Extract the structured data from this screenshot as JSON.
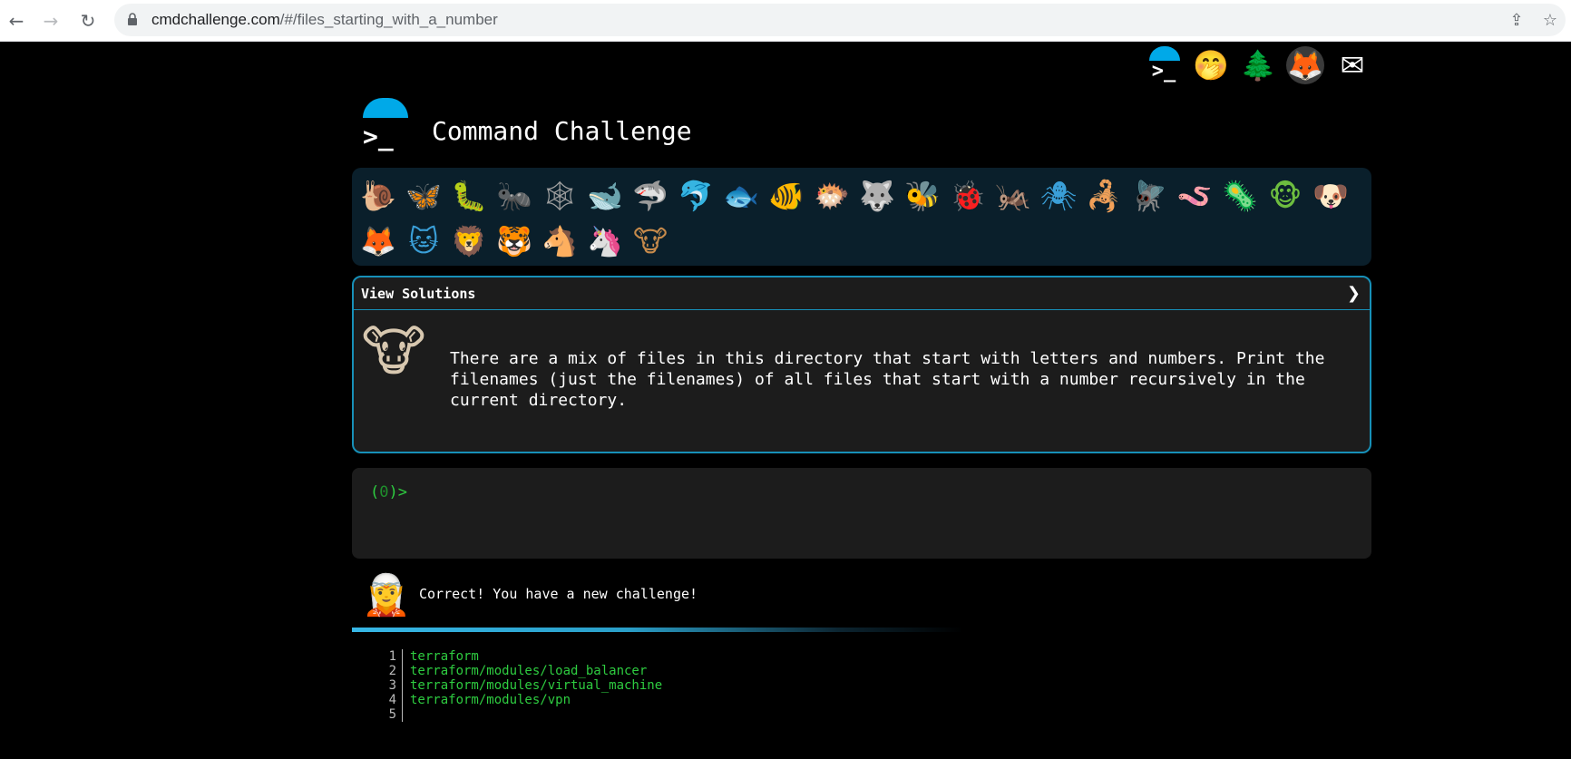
{
  "browser": {
    "url_host": "cmdchallenge.com",
    "url_path": "/#/files_starting_with_a_number",
    "back_icon": "back-arrow-icon",
    "forward_icon": "forward-arrow-icon",
    "reload_icon": "reload-icon",
    "share_icon": "share-icon",
    "star_icon": "bookmark-star-icon"
  },
  "header": {
    "title": "Command Challenge",
    "top_icons": [
      {
        "name": "cmdchallenge-icon",
        "glyph": ">_"
      },
      {
        "name": "oops-face-icon",
        "glyph": "🤭"
      },
      {
        "name": "tree-icon",
        "glyph": "🌲"
      },
      {
        "name": "gitlab-icon",
        "glyph": "🦊"
      },
      {
        "name": "mail-icon",
        "glyph": "✉"
      }
    ]
  },
  "levels": [
    {
      "name": "snail",
      "glyph": "🐌"
    },
    {
      "name": "butterfly",
      "glyph": "🦋"
    },
    {
      "name": "caterpillar",
      "glyph": "🐛"
    },
    {
      "name": "ant",
      "glyph": "🐜"
    },
    {
      "name": "spider-web",
      "glyph": "🕸"
    },
    {
      "name": "whale",
      "glyph": "🐋"
    },
    {
      "name": "shark",
      "glyph": "🦈"
    },
    {
      "name": "dolphin",
      "glyph": "🐬"
    },
    {
      "name": "fish",
      "glyph": "🐟"
    },
    {
      "name": "tropical-fish",
      "glyph": "🐠"
    },
    {
      "name": "blowfish",
      "glyph": "🐡"
    },
    {
      "name": "wolf",
      "glyph": "🐺"
    },
    {
      "name": "bee",
      "glyph": "🐝"
    },
    {
      "name": "ladybug",
      "glyph": "🐞"
    },
    {
      "name": "cricket",
      "glyph": "🦗"
    },
    {
      "name": "spider",
      "glyph": "🕷"
    },
    {
      "name": "scorpion",
      "glyph": "🦂"
    },
    {
      "name": "fly",
      "glyph": "🪰"
    },
    {
      "name": "worm",
      "glyph": "🪱"
    },
    {
      "name": "microbe",
      "glyph": "🦠"
    },
    {
      "name": "monkey",
      "glyph": "🐵"
    },
    {
      "name": "dog",
      "glyph": "🐶"
    },
    {
      "name": "fox",
      "glyph": "🦊"
    },
    {
      "name": "cat",
      "glyph": "🐱"
    },
    {
      "name": "lion",
      "glyph": "🦁"
    },
    {
      "name": "tiger",
      "glyph": "🐯"
    },
    {
      "name": "horse",
      "glyph": "🐴"
    },
    {
      "name": "unicorn",
      "glyph": "🦄"
    },
    {
      "name": "cow",
      "glyph": "🐮"
    }
  ],
  "solutions": {
    "title": "View Solutions",
    "chevron": "❯",
    "avatar_glyph": "🐮",
    "description": "There are a mix of files in this directory that start with letters and numbers. Print the filenames (just the filenames) of all files that start with a number recursively in the current directory."
  },
  "terminal": {
    "prompt_open": "(",
    "prompt_count": "0",
    "prompt_close": ")>"
  },
  "status": {
    "avatar_glyph": "🧝",
    "message": "Correct! You have a new challenge!",
    "progress": 0.6
  },
  "output": [
    {
      "n": "1",
      "text": "terraform"
    },
    {
      "n": "2",
      "text": "terraform/modules/load_balancer"
    },
    {
      "n": "3",
      "text": "terraform/modules/virtual_machine"
    },
    {
      "n": "4",
      "text": "terraform/modules/vpn"
    },
    {
      "n": "5",
      "text": ""
    }
  ]
}
